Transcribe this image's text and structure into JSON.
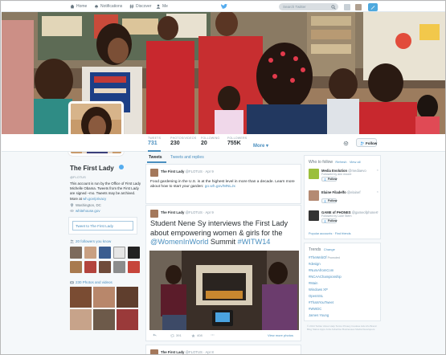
{
  "topbar": {
    "nav": [
      {
        "label": "Home",
        "icon": "home-icon"
      },
      {
        "label": "Notifications",
        "icon": "bell-icon"
      },
      {
        "label": "Discover",
        "icon": "hash-icon"
      },
      {
        "label": "Me",
        "icon": "person-icon"
      }
    ],
    "search_placeholder": "Search Twitter",
    "brand_color": "#55acee"
  },
  "stats": [
    {
      "label": "TWEETS",
      "value": "731",
      "active": true
    },
    {
      "label": "PHOTOS/VIDEOS",
      "value": "230"
    },
    {
      "label": "FOLLOWING",
      "value": "20"
    },
    {
      "label": "FOLLOWERS",
      "value": "755K"
    }
  ],
  "more_label": "More ▾",
  "follow_label": "Follow",
  "profile": {
    "name": "The First Lady",
    "handle": "@FLOTUS",
    "bio": "This account is run by the Office of First Lady Michelle Obama. Tweets from the First Lady are signed –mo. Tweets may be archived. More at",
    "bio_link": "wh.gov/privacy",
    "location": "Washington, DC",
    "website": "whitehouse.gov"
  },
  "tweet_to": "Tweet to The First Lady",
  "followers_you_know": "20 followers you know",
  "photos_videos": "230 Photos and videos",
  "tabs": {
    "tweets": "Tweets",
    "replies": "Tweets and replies"
  },
  "tweets": [
    {
      "name": "The First Lady",
      "meta": "@FLOTUS · Apr 9",
      "text": "Food gardening in the U.S. is at the highest level in more than a decade. Learn more about how to start your garden:",
      "link": "go.wh.gov/MNLJx"
    },
    {
      "name": "The First Lady",
      "meta": "@FLOTUS · Apr 9",
      "text": "Student Nene Sy interviews the First Lady about empowering women & girls for the",
      "mention": "@WomenInWorld",
      "text2": "Summit",
      "hashtag": "#WITW14",
      "retweets": "391",
      "favorites": "408",
      "view_more": "View more photos"
    },
    {
      "name": "The First Lady",
      "meta": "@FLOTUS · Apr 8"
    }
  ],
  "who_to_follow": {
    "title": "Who to follow",
    "refresh": "Refresh",
    "view_all": "View all",
    "items": [
      {
        "name": "Media Evolution",
        "handle": "@mediaevo",
        "sub": "Followed by ann moore",
        "button": "Follow"
      },
      {
        "name": "Elaine Filadelfo",
        "handle": "@elainef",
        "sub": "",
        "button": "Follow"
      },
      {
        "name": "GAME of PHONES",
        "handle": "@gameofphones",
        "sub": "Followed by Luke Stern",
        "button": "Follow"
      }
    ],
    "popular": "Popular accounts",
    "find_friends": "Find friends"
  },
  "trends": {
    "title": "Trends",
    "change": "Change",
    "items": [
      {
        "label": "#TheWebOf",
        "promoted": "Promoted"
      },
      {
        "label": "#design"
      },
      {
        "label": "#NumAfromCom"
      },
      {
        "label": "#NCAAChampionship"
      },
      {
        "label": "#Main"
      },
      {
        "label": "Windows XP"
      },
      {
        "label": "OpenSSL"
      },
      {
        "label": "#ThatsYouTweet"
      },
      {
        "label": "#WWDC"
      },
      {
        "label": "James Young"
      }
    ]
  },
  "footer": "© 2014 Twitter About Help Terms Privacy Cookies Ads info Brand Blog Status Apps Jobs Advertise Businesses Media Developers"
}
